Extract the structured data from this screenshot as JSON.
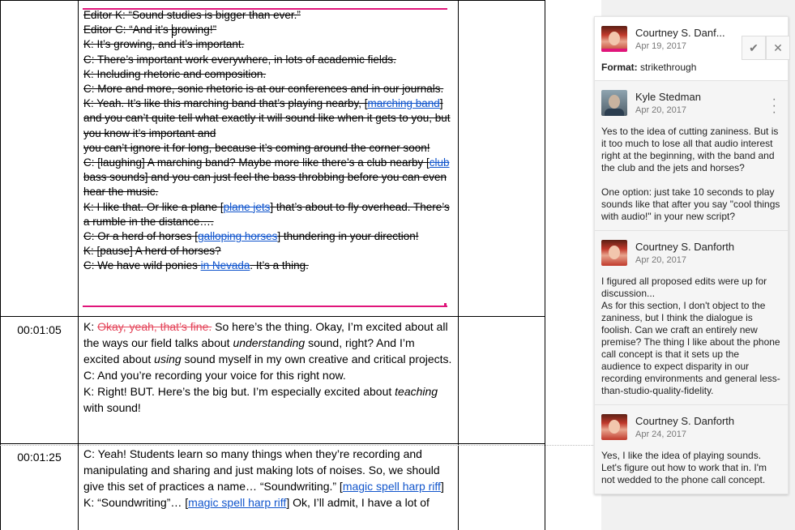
{
  "document": {
    "rows": [
      {
        "time": "",
        "lines": [
          {
            "segs": [
              {
                "t": "Editor K: “Sound studies is bigger than ever.”",
                "s": true
              }
            ]
          },
          {
            "segs": [
              {
                "t": "Editor C: “And it’s growing!”",
                "s": true
              }
            ]
          },
          {
            "segs": [
              {
                "t": "K: It’s growing, and it’s important.",
                "s": true
              }
            ]
          },
          {
            "segs": [
              {
                "t": "C: There’s important work everywhere, in lots of academic fields.",
                "s": true
              }
            ]
          },
          {
            "segs": [
              {
                "t": "K: Including rhetoric and composition.",
                "s": true
              }
            ]
          },
          {
            "segs": [
              {
                "t": "C: More and more, sonic rhetoric is at our conferences and in our journals.",
                "s": true
              }
            ]
          },
          {
            "segs": [
              {
                "t": "K: Yeah. It’s like this marching band that’s playing nearby, [",
                "s": true
              },
              {
                "t": "marching band",
                "s": true,
                "link": true
              },
              {
                "t": "] and you can’t quite tell what exactly it will sound like when it gets to you, but you know it’s important and",
                "s": true
              }
            ]
          },
          {
            "segs": [
              {
                "t": "you can’t ignore it for long, because it’s coming around the corner soon!",
                "s": true
              }
            ]
          },
          {
            "segs": [
              {
                "t": "C: [laughing] A marching band? Maybe more like there’s a club nearby [",
                "s": true
              },
              {
                "t": "club",
                "s": true,
                "link": true
              },
              {
                "t": " bass sounds] and you can just feel the bass throbbing before you can even hear the music.",
                "s": true
              }
            ]
          },
          {
            "segs": [
              {
                "t": "K: I like that. Or like a plane [",
                "s": true
              },
              {
                "t": "plane jets",
                "s": true,
                "link": true
              },
              {
                "t": "] that’s about to fly overhead. There’s a rumble in the distance….",
                "s": true
              }
            ]
          },
          {
            "segs": [
              {
                "t": "C: Or a herd of horses [",
                "s": true
              },
              {
                "t": "galloping horses",
                "s": true,
                "link": true
              },
              {
                "t": "] thundering in your direction!",
                "s": true
              }
            ]
          },
          {
            "segs": [
              {
                "t": "K: [pause] A herd of horses?",
                "s": true
              }
            ]
          },
          {
            "segs": [
              {
                "t": "C: We have wild ponies ",
                "s": true
              },
              {
                "t": "in Nevada",
                "s": true,
                "link": true
              },
              {
                "t": ". It’s a thing.",
                "s": true
              }
            ]
          }
        ]
      },
      {
        "time": "00:01:05",
        "lines": [
          {
            "segs": [
              {
                "t": "K: "
              },
              {
                "t": "Okay, yeah, that’s fine.",
                "pink": true
              },
              {
                "t": " So here’s the thing. Okay, I’m excited about all the ways our field talks about "
              },
              {
                "t": "understanding",
                "i": true
              },
              {
                "t": " sound, right? And I’m excited about "
              },
              {
                "t": "using",
                "i": true
              },
              {
                "t": " sound myself in my own creative and critical projects."
              }
            ]
          },
          {
            "segs": [
              {
                "t": "C: And you’re recording your voice for this right now."
              }
            ]
          },
          {
            "segs": [
              {
                "t": "K: Right!  BUT. Here’s the big but. I’m especially excited about "
              },
              {
                "t": "teaching",
                "i": true
              },
              {
                "t": " with sound!"
              }
            ]
          }
        ]
      },
      {
        "time": "00:01:25",
        "lines": [
          {
            "segs": [
              {
                "t": "C: Yeah! Students learn so many things when they’re recording and manipulating and sharing and just making lots of noises. So, we should give this set of practices a name… “Soundwriting.” ["
              },
              {
                "t": "magic spell harp riff",
                "link": true
              },
              {
                "t": "]"
              }
            ]
          },
          {
            "segs": [
              {
                "t": "K: “Soundwriting”… ["
              },
              {
                "t": "magic spell harp riff",
                "link": true
              },
              {
                "t": "] Ok, I’ll admit, I have a lot of"
              }
            ]
          }
        ]
      }
    ]
  },
  "comments": [
    {
      "author": "Courtney S. Danf...",
      "date": "Apr 19, 2017",
      "format_label": "Format:",
      "format_value": " strikethrough",
      "avatar": "courtney"
    },
    {
      "author": "Kyle Stedman",
      "date": "Apr 20, 2017",
      "avatar": "kyle",
      "paragraphs": [
        "Yes to the idea of cutting zaniness. But is it too much to lose all that audio interest right at the beginning, with the band and the club and the jets and horses?",
        "One option: just take 10 seconds to play sounds like that after you say \"cool things with audio!\" in your new script?"
      ]
    },
    {
      "author": "Courtney S. Danforth",
      "date": "Apr 20, 2017",
      "avatar": "courtney",
      "paragraphs": [
        "I figured all proposed edits were up for discussion...\nAs for this section, I don't object to the zaniness, but I think the dialogue is foolish. Can we craft an entirely new premise? The thing I like about the phone call concept is that it sets up the audience to expect disparity in our recording environments and general less-than-studio-quality-fidelity."
      ]
    },
    {
      "author": "Courtney S. Danforth",
      "date": "Apr 24, 2017",
      "avatar": "courtney",
      "paragraphs": [
        "Yes, I like the idea of playing sounds. Let's figure out how to work that in. I'm not wedded to the phone call concept."
      ]
    }
  ],
  "icons": {
    "resolve": "checkmark-icon",
    "close": "close-icon",
    "more": "more-vert-icon"
  },
  "colors": {
    "selection": "#e0157a",
    "link": "#1155cc",
    "deleted_suggestion": "#e4455a"
  }
}
